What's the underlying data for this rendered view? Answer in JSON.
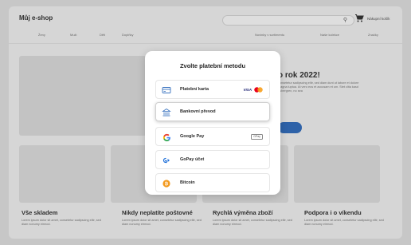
{
  "shop": {
    "logo": "Můj e-shop",
    "cart_label": "Nákupní košík",
    "nav_left": [
      "Ženy",
      "Muži",
      "Děti",
      "Doplňky"
    ],
    "nav_right": [
      "Novinky v sortimentu",
      "Naše kolekce",
      "Značky"
    ]
  },
  "hero": {
    "title": "o rok 2022!",
    "text": "consetetur sadipscing elitr, sed diam dunt ut labore et dolore magna luptua. At vero eos et accusam et um. Stet clita kasd gubergren, no sea"
  },
  "features": [
    {
      "title": "Vše skladem",
      "text": "Lorem ipsum dolor sit amet, consetetur sadipscing elitr, sed diam nonumy eirmod."
    },
    {
      "title": "Nikdy neplatíte poštovné",
      "text": "Lorem ipsum dolor sit amet, consetetur sadipscing elitr, sed diam nonumy eirmod."
    },
    {
      "title": "Rychlá výměna zboží",
      "text": "Lorem ipsum dolor sit amet, consetetur sadipscing elitr, sed diam nonumy eirmod."
    },
    {
      "title": "Podpora i o víkendu",
      "text": "Lorem ipsum dolor sit amet, consetetur sadipscing elitr, sed diam nonumy eirmod."
    }
  ],
  "modal": {
    "title": "Zvolte platební metodu",
    "options": [
      {
        "label": "Platební karta",
        "icon": "credit-card-icon",
        "brand": "VISA"
      },
      {
        "label": "Bankovní převod",
        "icon": "bank-icon",
        "selected": true
      },
      {
        "label": "Google Pay",
        "icon": "google-icon",
        "brand": "GPay"
      },
      {
        "label": "GoPay účet",
        "icon": "gopay-icon"
      },
      {
        "label": "Bitcoin",
        "icon": "bitcoin-icon"
      }
    ]
  },
  "colors": {
    "overlay_bg": "#c7c7c7",
    "modal_bg": "#ffffff",
    "accent_blue": "#2e62a8",
    "bitcoin_orange": "#f39a1e",
    "mastercard_red": "#eb001b",
    "mastercard_orange": "#f79e1b"
  }
}
